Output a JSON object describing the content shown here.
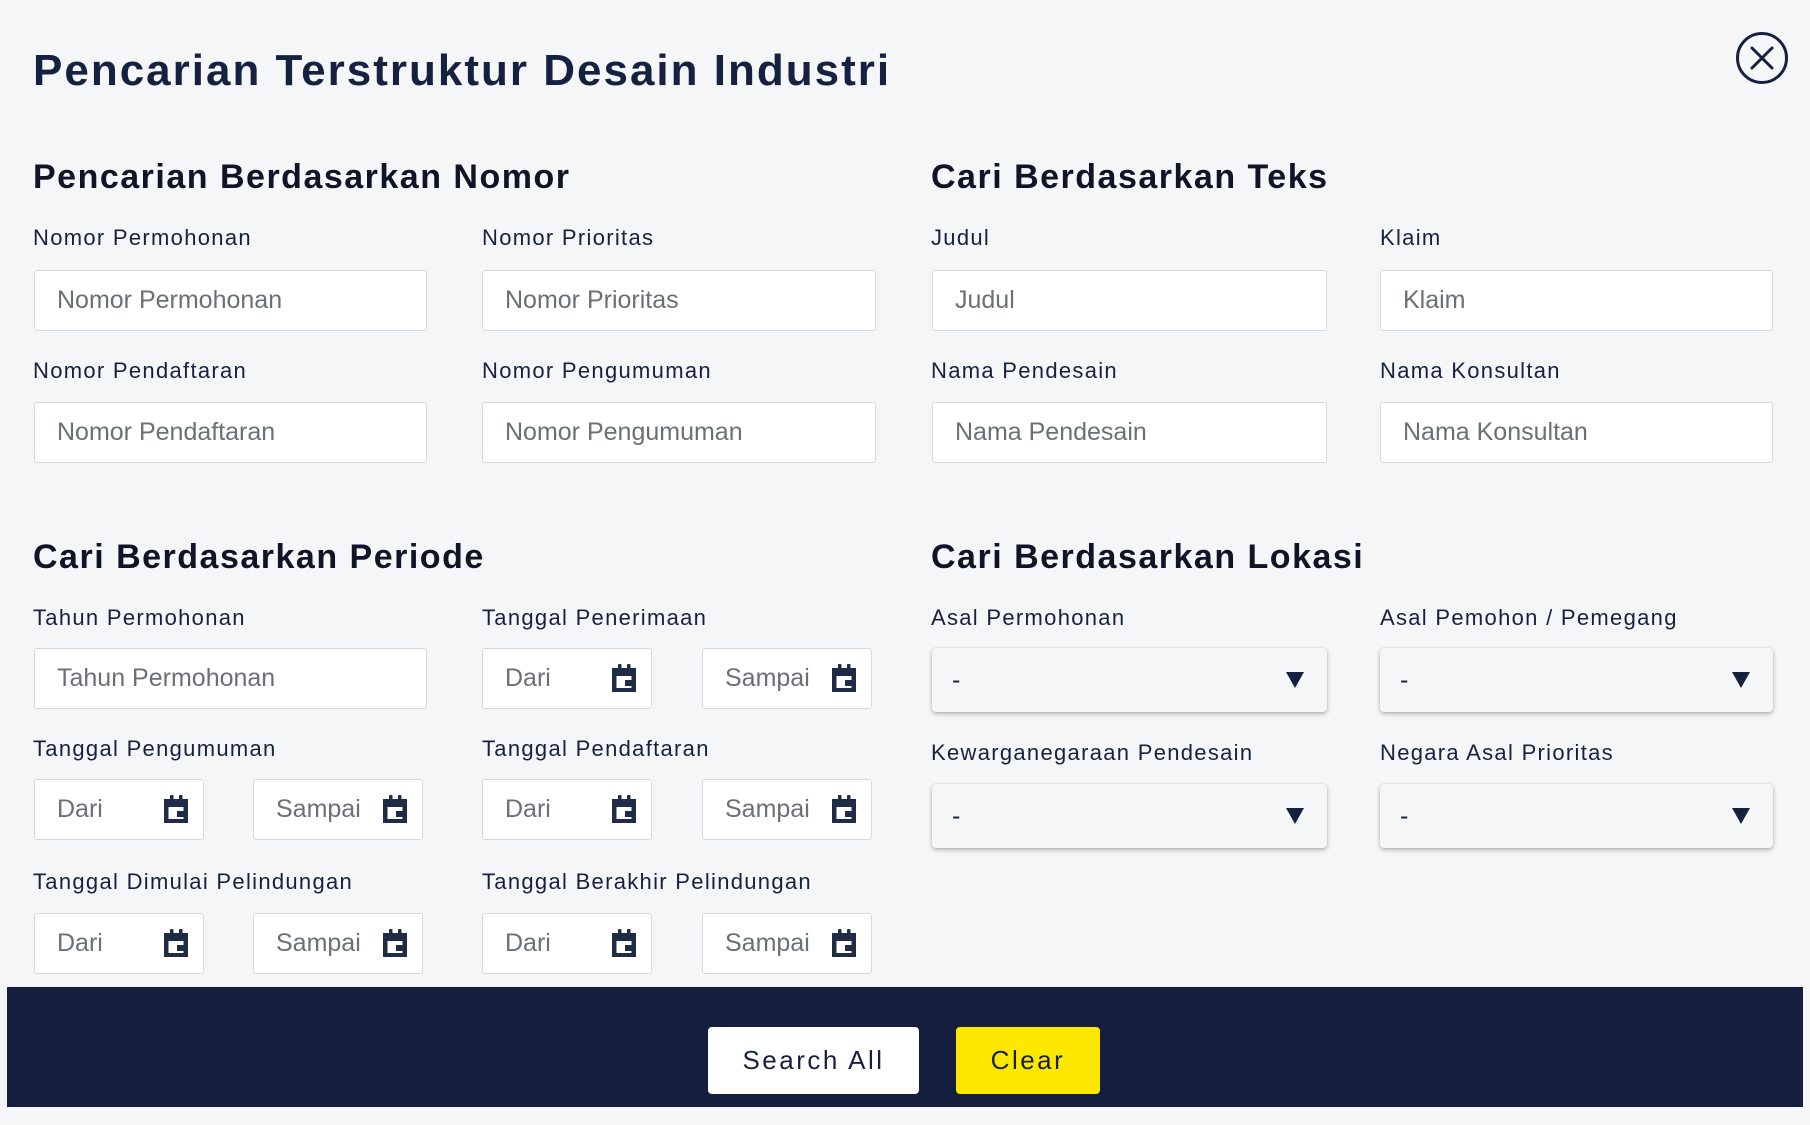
{
  "title": "Pencarian Terstruktur Desain Industri",
  "close_icon": "close-circle-icon",
  "colors": {
    "navy": "#141f40",
    "accent_yellow": "#ffe800",
    "background": "#f5f6f8"
  },
  "nomor": {
    "title": "Pencarian Berdasarkan Nomor",
    "permohonan": {
      "label": "Nomor Permohonan",
      "placeholder": "Nomor Permohonan"
    },
    "prioritas": {
      "label": "Nomor Prioritas",
      "placeholder": "Nomor Prioritas"
    },
    "pendaftaran": {
      "label": "Nomor Pendaftaran",
      "placeholder": "Nomor Pendaftaran"
    },
    "pengumuman": {
      "label": "Nomor Pengumuman",
      "placeholder": "Nomor Pengumuman"
    }
  },
  "teks": {
    "title": "Cari Berdasarkan Teks",
    "judul": {
      "label": "Judul",
      "placeholder": "Judul"
    },
    "klaim": {
      "label": "Klaim",
      "placeholder": "Klaim"
    },
    "pendesain": {
      "label": "Nama Pendesain",
      "placeholder": "Nama Pendesain"
    },
    "konsultan": {
      "label": "Nama Konsultan",
      "placeholder": "Nama Konsultan"
    }
  },
  "periode": {
    "title": "Cari Berdasarkan Periode",
    "tahun": {
      "label": "Tahun Permohonan",
      "placeholder": "Tahun Permohonan"
    },
    "penerimaan": {
      "label": "Tanggal Penerimaan",
      "from": "Dari",
      "to": "Sampai"
    },
    "pengumuman": {
      "label": "Tanggal Pengumuman",
      "from": "Dari",
      "to": "Sampai"
    },
    "pendaftaran": {
      "label": "Tanggal Pendaftaran",
      "from": "Dari",
      "to": "Sampai"
    },
    "mulai": {
      "label": "Tanggal Dimulai Pelindungan",
      "from": "Dari",
      "to": "Sampai"
    },
    "berakhir": {
      "label": "Tanggal Berakhir Pelindungan",
      "from": "Dari",
      "to": "Sampai"
    }
  },
  "lokasi": {
    "title": "Cari Berdasarkan Lokasi",
    "asal_permohonan": {
      "label": "Asal Permohonan",
      "value": "-"
    },
    "asal_pemohon": {
      "label": "Asal Pemohon / Pemegang",
      "value": "-"
    },
    "kewarganegaraan": {
      "label": "Kewarganegaraan Pendesain",
      "value": "-"
    },
    "negara_prioritas": {
      "label": "Negara Asal Prioritas",
      "value": "-"
    }
  },
  "footer": {
    "search_label": "Search All",
    "clear_label": "Clear"
  }
}
